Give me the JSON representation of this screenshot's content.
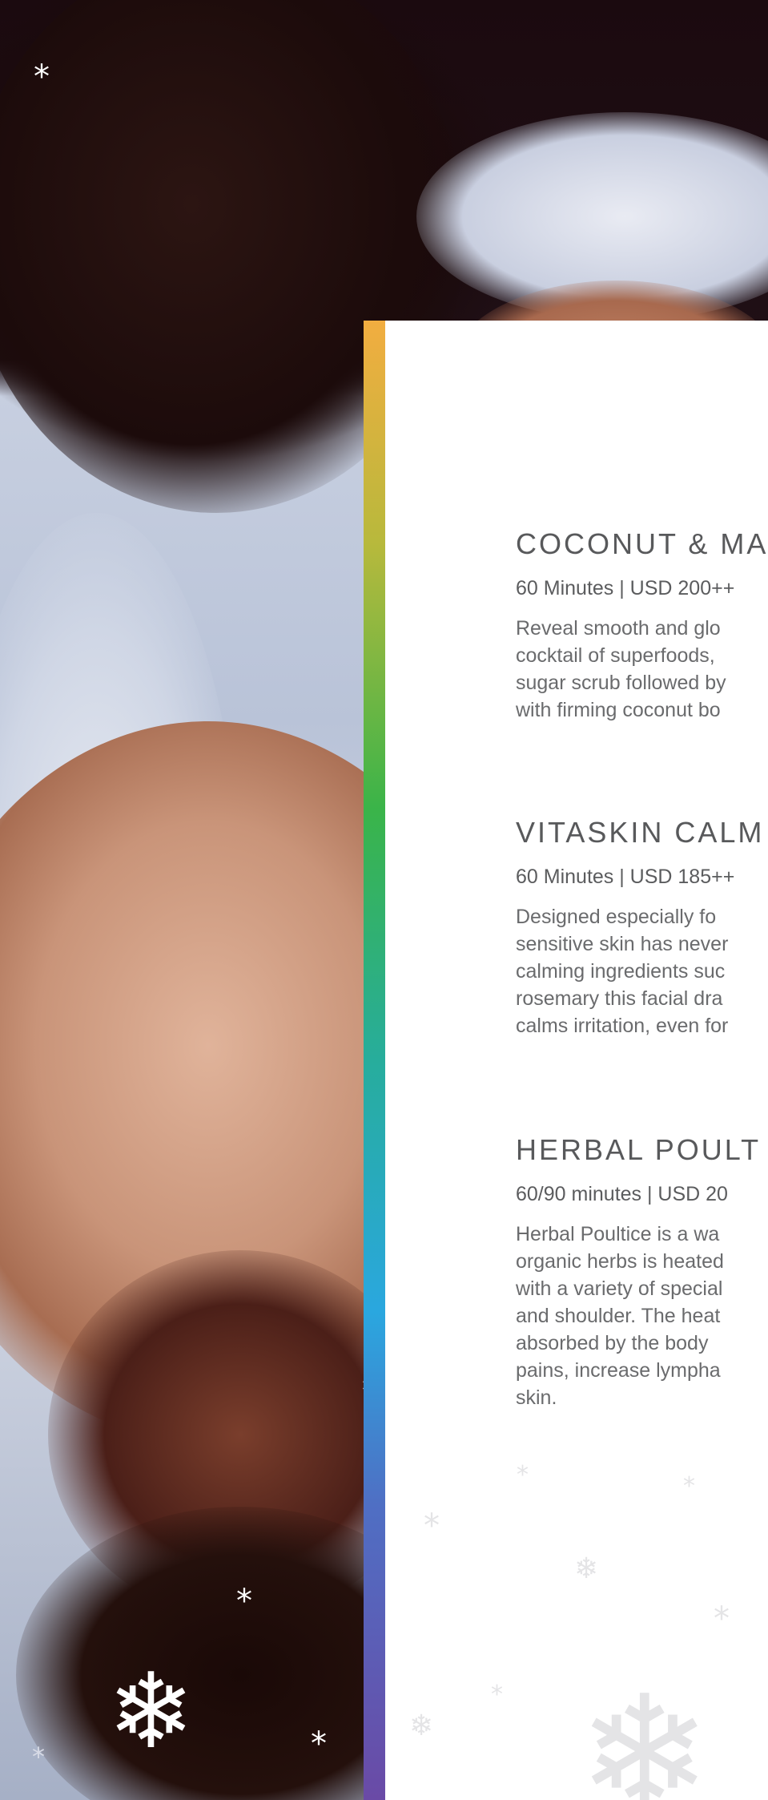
{
  "treatments": [
    {
      "title": "COCONUT & MA",
      "meta": "60 Minutes | USD 200++",
      "lines": [
        "Reveal smooth and glo",
        "cocktail of superfoods,",
        "sugar scrub followed by",
        "with firming coconut bo"
      ]
    },
    {
      "title": "VITASKIN CALM",
      "meta": "60 Minutes | USD 185++",
      "lines": [
        "Designed especially fo",
        "sensitive skin has never",
        "calming ingredients suc",
        "rosemary this facial dra",
        "calms irritation, even for"
      ]
    },
    {
      "title": "HERBAL POULT",
      "meta": "60/90 minutes |  USD 20",
      "lines": [
        "Herbal Poultice is a wa",
        "organic herbs is heated",
        "with a variety of special",
        "and shoulder. The heat",
        "absorbed by the body",
        "pains, increase lympha",
        "skin."
      ]
    }
  ],
  "decor": {
    "star_glyph": "*",
    "snowflake_icon": "❄",
    "strip_colors": [
      "#f2ad40",
      "#b8b93c",
      "#3ab449",
      "#27ad9c",
      "#2aa7df",
      "#4f6fc4",
      "#6a4aa6"
    ]
  }
}
